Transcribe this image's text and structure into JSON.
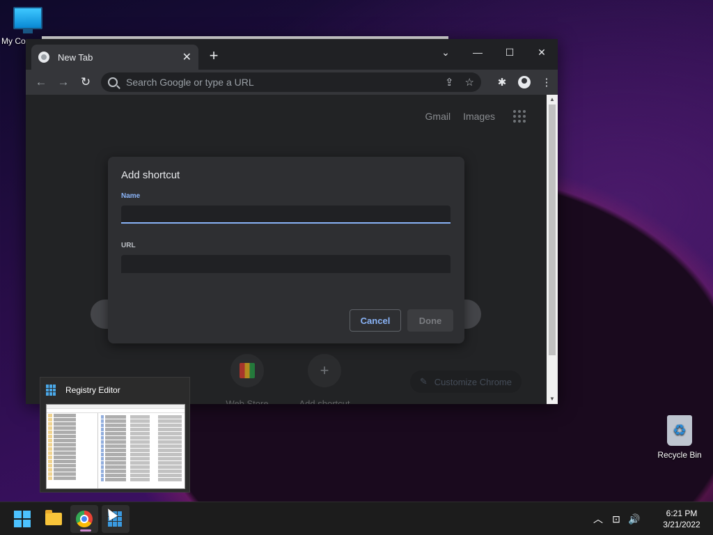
{
  "desktop": {
    "icons": [
      {
        "label": "My Co",
        "icon": "monitor-icon"
      },
      {
        "label": "Recycle Bin",
        "icon": "recycle-bin-icon"
      }
    ]
  },
  "browser": {
    "tab_title": "New Tab",
    "tab_close": "✕",
    "new_tab": "+",
    "window_controls": {
      "dropdown": "⌄",
      "minimize": "—",
      "maximize": "☐",
      "close": "✕"
    },
    "omnibox_placeholder": "Search Google or type a URL",
    "nav": {
      "back": "←",
      "forward": "→",
      "reload": "↻"
    },
    "top_links": {
      "gmail": "Gmail",
      "images": "Images"
    },
    "shortcuts": [
      {
        "label": "Web Store",
        "icon": "web-store-icon"
      },
      {
        "label": "Add shortcut",
        "icon": "+"
      }
    ],
    "customize_label": "Customize Chrome",
    "customize_icon": "✎"
  },
  "dialog": {
    "title": "Add shortcut",
    "name_label": "Name",
    "name_value": "",
    "url_label": "URL",
    "url_value": "",
    "cancel": "Cancel",
    "done": "Done"
  },
  "preview": {
    "title": "Registry Editor"
  },
  "taskbar": {
    "apps": [
      "start-icon",
      "file-explorer-icon",
      "chrome-icon",
      "registry-editor-icon"
    ],
    "tray": {
      "chevron": "︿",
      "network": "⊡",
      "volume": "🔊"
    },
    "time": "6:21 PM",
    "date": "3/21/2022"
  },
  "colors": {
    "accent": "#8ab4f8",
    "browser_bg": "#202124",
    "taskbar_bg": "#1c1c1c"
  }
}
